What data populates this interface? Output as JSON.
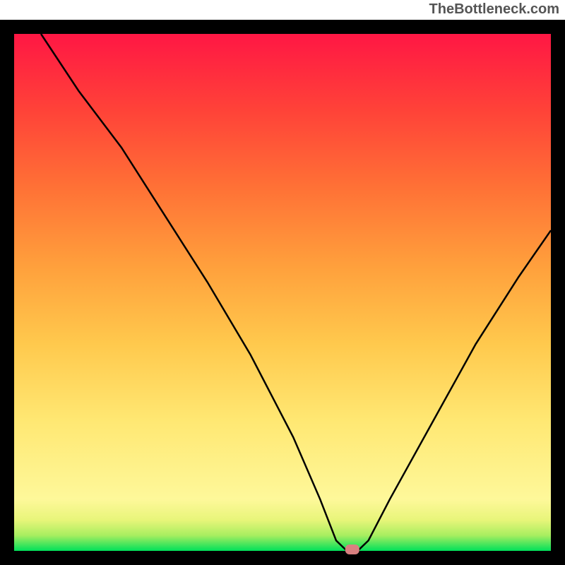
{
  "watermark": "TheBottleneck.com",
  "chart_data": {
    "type": "line",
    "title": "",
    "xlabel": "",
    "ylabel": "",
    "xlim": [
      0,
      100
    ],
    "ylim": [
      0,
      100
    ],
    "series": [
      {
        "name": "bottleneck-curve",
        "x": [
          5,
          12,
          20,
          28,
          36,
          44,
          52,
          57,
          60,
          62,
          64,
          66,
          70,
          78,
          86,
          94,
          100
        ],
        "values": [
          100,
          89,
          78,
          65,
          52,
          38,
          22,
          10,
          2,
          0,
          0,
          2,
          10,
          25,
          40,
          53,
          62
        ]
      }
    ],
    "marker": {
      "x": 63,
      "y": 0
    },
    "gradient_stops": [
      {
        "offset": 0,
        "color": "#00e05a"
      },
      {
        "offset": 3,
        "color": "#a8ee60"
      },
      {
        "offset": 6,
        "color": "#e8f57a"
      },
      {
        "offset": 10,
        "color": "#fef89a"
      },
      {
        "offset": 25,
        "color": "#ffe873"
      },
      {
        "offset": 40,
        "color": "#ffc94d"
      },
      {
        "offset": 55,
        "color": "#ffa03c"
      },
      {
        "offset": 70,
        "color": "#ff7236"
      },
      {
        "offset": 85,
        "color": "#ff4338"
      },
      {
        "offset": 100,
        "color": "#ff1744"
      }
    ],
    "frame_color": "#000000",
    "curve_color": "#000000",
    "marker_color": "#d98080"
  }
}
